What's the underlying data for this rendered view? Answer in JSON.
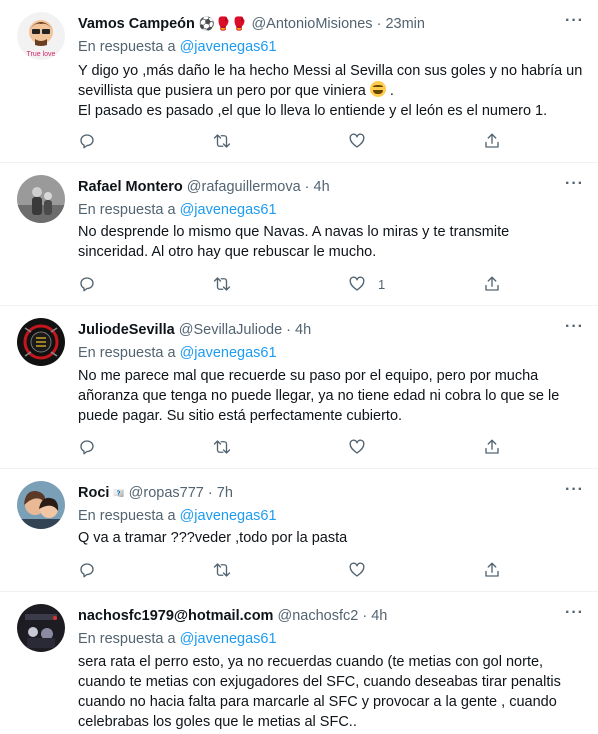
{
  "tweets": [
    {
      "name": "Vamos Campeón",
      "name_emoji": "⚽🥊🥊",
      "handle": "@AntonioMisiones",
      "dot": "·",
      "time": "23min",
      "reply_prefix": "En respuesta a",
      "reply_to": "@javenegas61",
      "lines": [
        "Y digo yo ,más daño le ha hecho Messi al Sevilla con sus goles y no habría un sevillista que pusiera un pero por que viniera",
        "El pasado es pasado ,el que lo lleva lo entiende y el león es el numero 1."
      ],
      "avatar_text": "True love",
      "like_count": ""
    },
    {
      "name": "Rafael Montero",
      "handle": "@rafaguillermova",
      "dot": "·",
      "time": "4h",
      "reply_prefix": "En respuesta a",
      "reply_to": "@javenegas61",
      "lines": [
        "No desprende lo mismo que Navas. A navas lo miras y te transmite sinceridad. Al otro hay que rebuscar le mucho."
      ],
      "like_count": "1"
    },
    {
      "name": "JuliodeSevilla",
      "handle": "@SevillaJuliode",
      "dot": "·",
      "time": "4h",
      "reply_prefix": "En respuesta a",
      "reply_to": "@javenegas61",
      "lines": [
        "No me parece mal que recuerde su paso por el equipo, pero por mucha añoranza que tenga no puede llegar, ya no tiene edad ni cobra lo que se le puede pagar. Su sitio está perfectamente cubierto."
      ],
      "like_count": ""
    },
    {
      "name": "Roci",
      "name_suffix": "🇫🇫",
      "handle": "@ropas777",
      "dot": "·",
      "time": "7h",
      "reply_prefix": "En respuesta a",
      "reply_to": "@javenegas61",
      "lines": [
        "Q va a tramar ???veder ,todo por la pasta"
      ],
      "like_count": ""
    },
    {
      "name": "nachosfc1979@hotmail.com",
      "handle": "@nachosfc2",
      "dot": "·",
      "time": "4h",
      "reply_prefix": "En respuesta a",
      "reply_to": "@javenegas61",
      "lines": [
        "sera rata el perro esto, ya no recuerdas cuando (te metias con gol norte, cuando te metias con exjugadores del SFC, cuando deseabas tirar penaltis cuando no hacia falta para marcarle al SFC y provocar a la gente , cuando celebrabas los goles que le metias al SFC.."
      ],
      "like_count": ""
    }
  ],
  "colors": {
    "text": "#0f1419",
    "secondary": "#536471",
    "link": "#1d9bf0",
    "divider": "#eff3f4"
  },
  "icons": [
    "more-icon",
    "reply-icon",
    "retweet-icon",
    "like-icon",
    "share-icon"
  ]
}
